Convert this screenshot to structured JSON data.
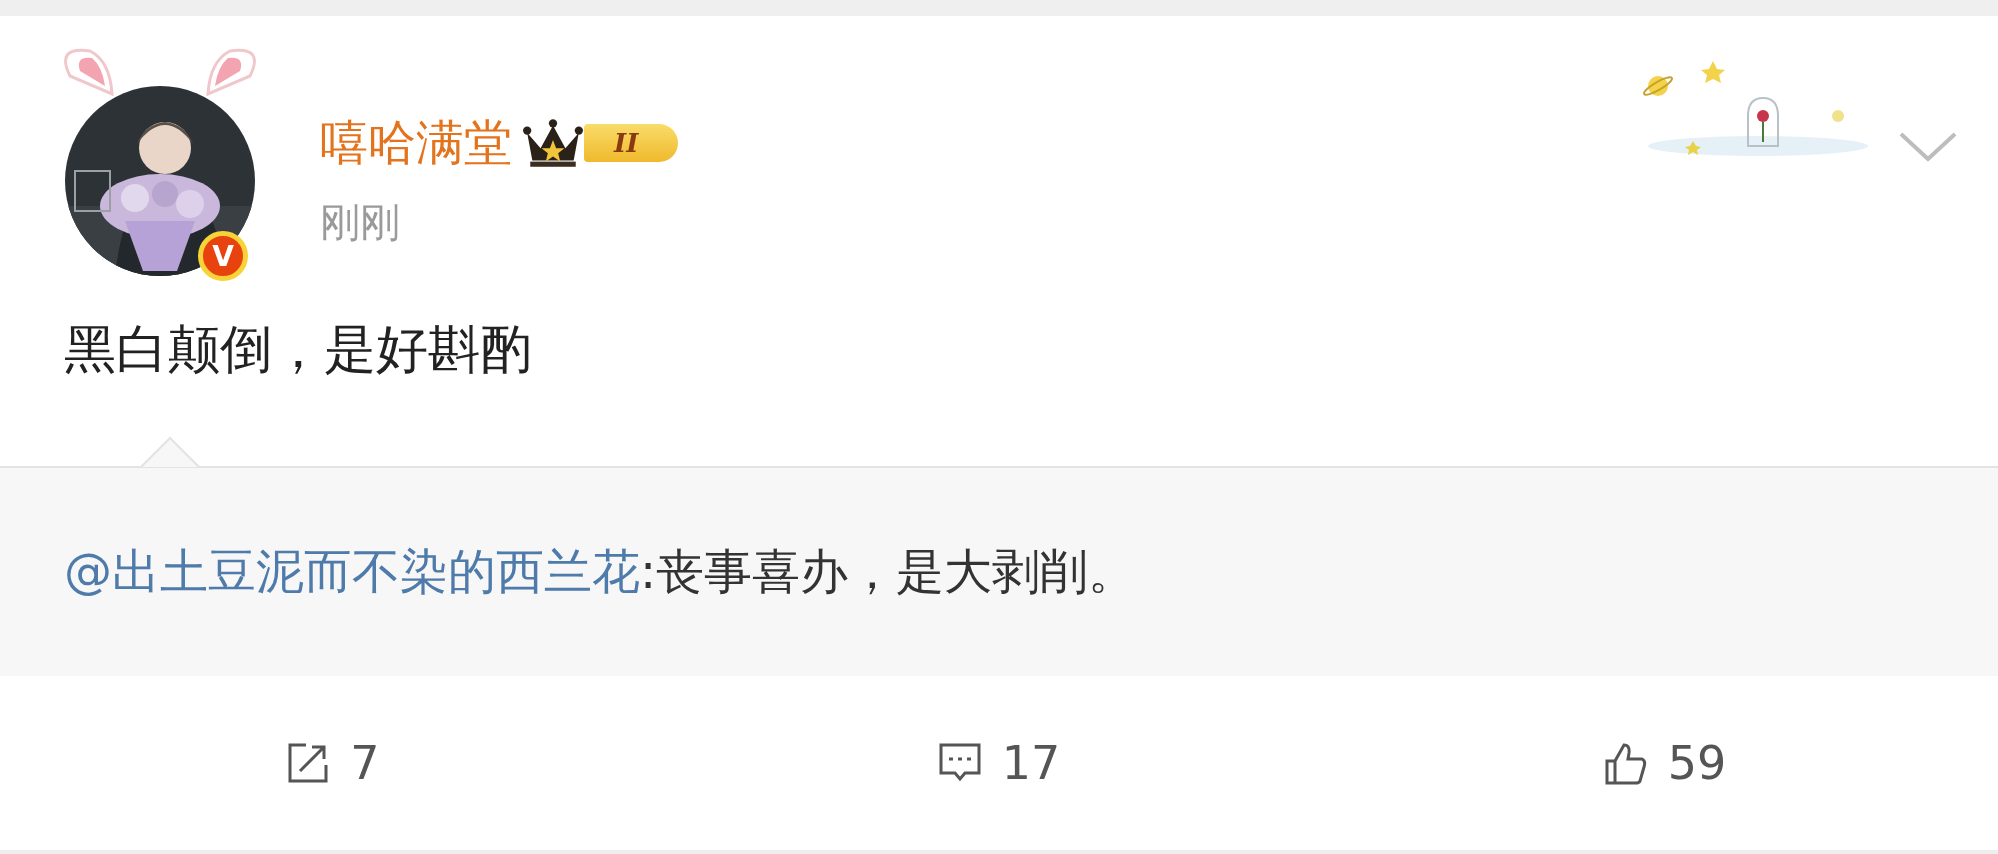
{
  "post": {
    "author": "嘻哈满堂",
    "level_badge": "II",
    "verified_mark": "V",
    "time": "刚刚",
    "text": "黑白颠倒，是好斟酌"
  },
  "repost": {
    "mention": "@出土豆泥而不染的西兰花",
    "text": ":丧事喜办，是大剥削。"
  },
  "actions": [
    {
      "kind": "repost",
      "count": "7"
    },
    {
      "kind": "comment",
      "count": "17"
    },
    {
      "kind": "like",
      "count": "59"
    }
  ]
}
